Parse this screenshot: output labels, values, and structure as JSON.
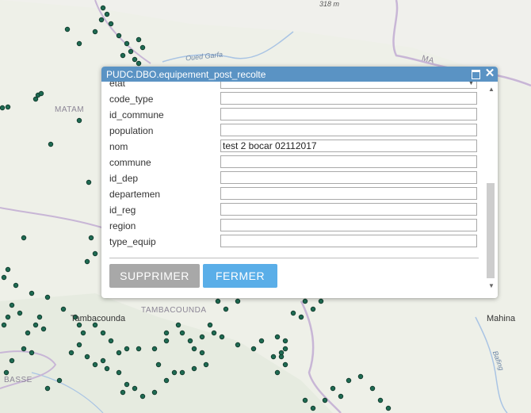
{
  "map": {
    "labels": {
      "matam": "MATAM",
      "tambacounda_region": "TAMBACOUNDA",
      "tambacounda_city": "Tambacounda",
      "basse": "BASSE",
      "mahina": "Mahina",
      "oued_garfa": "Oued Garfa",
      "bafing": "Bafing",
      "elev_318": "318 m",
      "ma_partial": "MA"
    },
    "colors": {
      "land": "#eef0e8",
      "border": "#c8b6d6",
      "river": "#a9c4e4",
      "point": "#1e6a52"
    }
  },
  "popup": {
    "title": "PUDC.DBO.equipement_post_recolte",
    "fields": [
      {
        "label": "etat",
        "value": ""
      },
      {
        "label": "code_type",
        "value": ""
      },
      {
        "label": "id_commune",
        "value": ""
      },
      {
        "label": "population",
        "value": ""
      },
      {
        "label": "nom",
        "value": "test 2 bocar 02112017"
      },
      {
        "label": "commune",
        "value": ""
      },
      {
        "label": "id_dep",
        "value": ""
      },
      {
        "label": "departemen",
        "value": ""
      },
      {
        "label": "id_reg",
        "value": ""
      },
      {
        "label": "region",
        "value": ""
      },
      {
        "label": "type_equip",
        "value": ""
      }
    ],
    "buttons": {
      "delete": "SUPPRIMER",
      "close": "FERMER"
    },
    "icons": {
      "maximize": "maximize-icon",
      "close": "close-icon"
    }
  }
}
